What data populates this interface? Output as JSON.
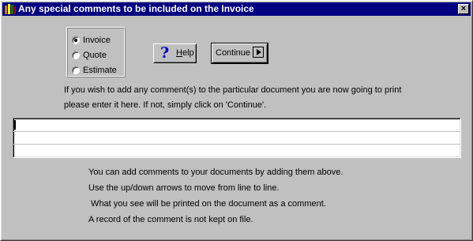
{
  "window": {
    "title": "Any special comments to be included on the Invoice",
    "close_label": "×"
  },
  "document_type": {
    "options": [
      {
        "label": "Invoice",
        "selected": true
      },
      {
        "label": "Quote",
        "selected": false
      },
      {
        "label": "Estimate",
        "selected": false
      }
    ]
  },
  "buttons": {
    "help_label_underlined": "H",
    "help_label_rest": "elp",
    "help_icon": "?",
    "continue_label": "Continue"
  },
  "instructions": {
    "line1": "If you wish to add any comment(s) to the particular document you are now going to print",
    "line2": "please enter it here.   If not, simply click on 'Continue'."
  },
  "comments": {
    "lines": [
      "",
      "",
      ""
    ]
  },
  "help_text": {
    "line1": "You can add comments to your documents by adding them above.",
    "line2": "Use the up/down arrows to move from line to line.",
    "line3": " What you see will be printed on the document as a comment.",
    "line4": "A record of the comment is not kept on file."
  },
  "colors": {
    "titlebar": "#000080",
    "face": "#c0c0c0"
  }
}
